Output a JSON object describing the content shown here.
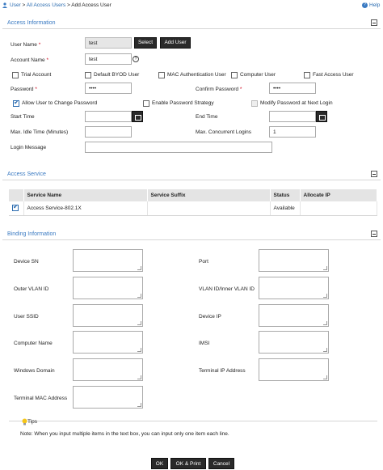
{
  "breadcrumb": {
    "item1": "User",
    "sep1": ">",
    "item2": "All Access Users",
    "sep2": ">",
    "current": "Add Access User"
  },
  "help": "Help",
  "access_info": {
    "title": "Access Information",
    "user_name_label": "User Name",
    "user_name_value": "test",
    "select_button": "Select",
    "add_user_button": "Add User",
    "account_name_label": "Account Name",
    "account_name_value": "test",
    "trial_account": "Trial Account",
    "default_byod_user": "Default BYOD User",
    "mac_auth_user": "MAC Authentication User",
    "computer_user": "Computer User",
    "fast_access_user": "Fast Access User",
    "password_label": "Password",
    "password_value": "••••",
    "confirm_password_label": "Confirm Password",
    "confirm_password_value": "••••",
    "allow_change_password": "Allow User to Change Password",
    "enable_password_strategy": "Enable Password Strategy",
    "modify_password_next_login": "Modify Password at Next Login",
    "start_time_label": "Start Time",
    "start_time_value": "",
    "end_time_label": "End Time",
    "end_time_value": "",
    "max_idle_label": "Max. Idle Time (Minutes)",
    "max_idle_value": "",
    "max_logins_label": "Max. Concurrent Logins",
    "max_logins_value": "1",
    "login_message_label": "Login Message",
    "login_message_value": "",
    "required_mark": "*"
  },
  "access_service": {
    "title": "Access Service",
    "columns": [
      "Service Name",
      "Service Suffix",
      "Status",
      "Allocate IP"
    ],
    "rows": [
      {
        "name": "Access Service-802.1X",
        "suffix": "",
        "status": "Available",
        "allocate_ip": ""
      }
    ]
  },
  "binding_info": {
    "title": "Binding Information",
    "device_sn": "Device SN",
    "port": "Port",
    "outer_vlan": "Outer VLAN ID",
    "vlan_inner": "VLAN ID/Inner VLAN ID",
    "user_ssid": "User SSID",
    "device_ip": "Device IP",
    "computer_name": "Computer Name",
    "imsi": "IMSI",
    "windows_domain": "Windows Domain",
    "terminal_ip": "Terminal IP Address",
    "terminal_mac": "Terminal MAC Address"
  },
  "tips": {
    "title": "Tips",
    "note": "Note: When you input multiple items in the text box, you can input only one item each line."
  },
  "buttons": {
    "ok": "OK",
    "ok_print": "OK & Print",
    "cancel": "Cancel"
  },
  "colors": {
    "accent": "#3a7ac2",
    "button_dark": "#2a2a2a",
    "required": "#d0021b"
  }
}
